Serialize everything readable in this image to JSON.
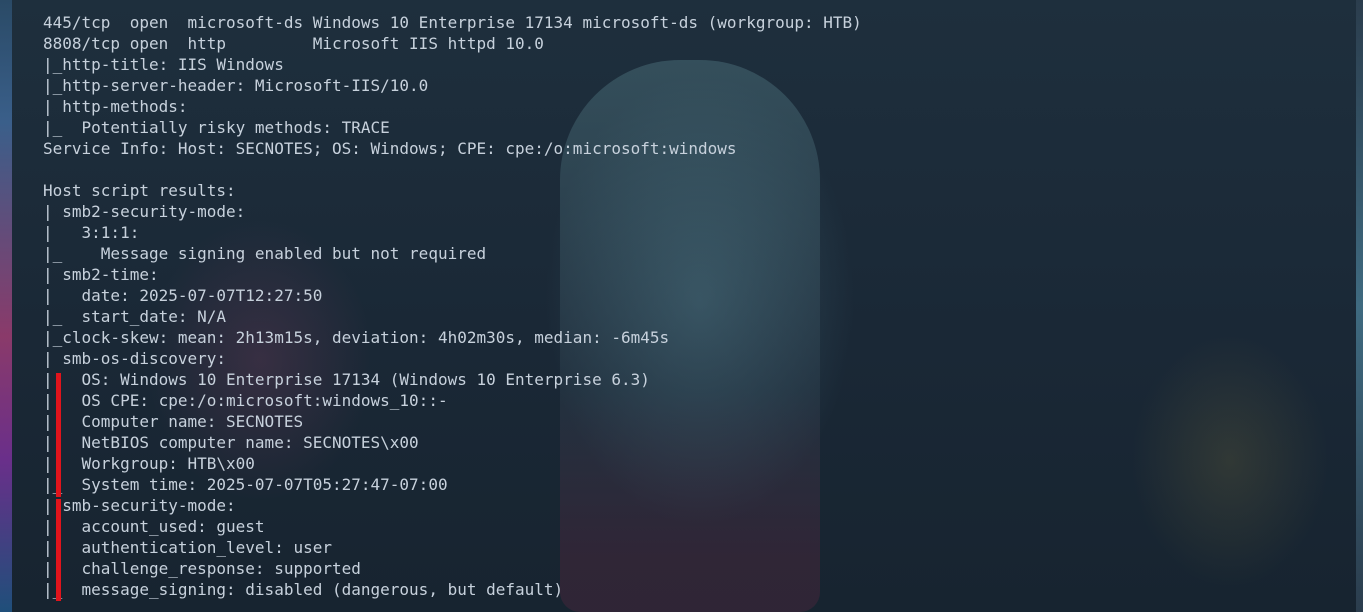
{
  "terminal": {
    "lines": [
      "445/tcp  open  microsoft-ds Windows 10 Enterprise 17134 microsoft-ds (workgroup: HTB)",
      "8808/tcp open  http         Microsoft IIS httpd 10.0",
      "|_http-title: IIS Windows",
      "|_http-server-header: Microsoft-IIS/10.0",
      "| http-methods:",
      "|_  Potentially risky methods: TRACE",
      "Service Info: Host: SECNOTES; OS: Windows; CPE: cpe:/o:microsoft:windows",
      "",
      "Host script results:",
      "| smb2-security-mode:",
      "|   3:1:1:",
      "|_    Message signing enabled but not required",
      "| smb2-time:",
      "|   date: 2025-07-07T12:27:50",
      "|_  start_date: N/A",
      "|_clock-skew: mean: 2h13m15s, deviation: 4h02m30s, median: -6m45s",
      "| smb-os-discovery:",
      "|   OS: Windows 10 Enterprise 17134 (Windows 10 Enterprise 6.3)",
      "|   OS CPE: cpe:/o:microsoft:windows_10::-",
      "|   Computer name: SECNOTES",
      "|   NetBIOS computer name: SECNOTES\\x00",
      "|   Workgroup: HTB\\x00",
      "|_  System time: 2025-07-07T05:27:47-07:00",
      "| smb-security-mode:",
      "|   account_used: guest",
      "|   authentication_level: user",
      "|   challenge_response: supported",
      "|_  message_signing: disabled (dangerous, but default)"
    ]
  },
  "colors": {
    "text": "#c7d1dc",
    "highlight_marker": "#e0141c",
    "background": "#1b2a37"
  }
}
